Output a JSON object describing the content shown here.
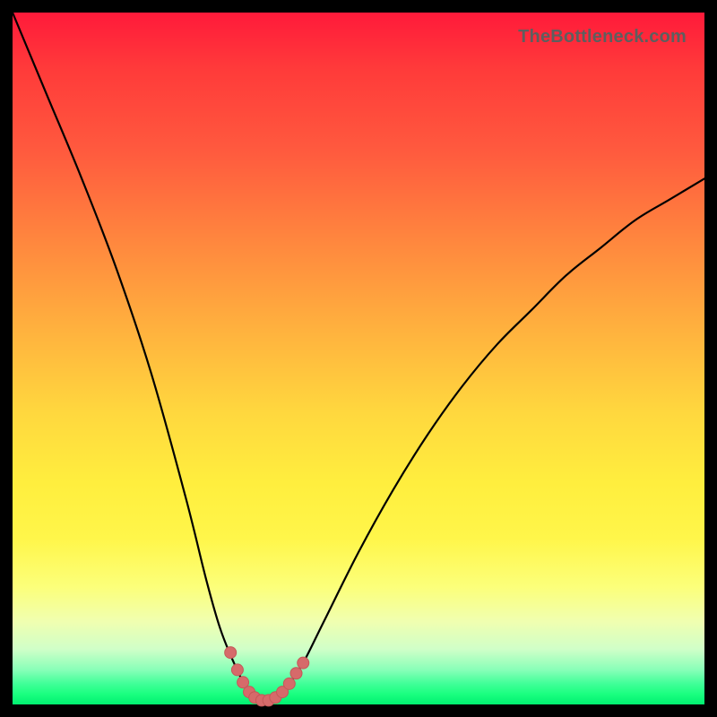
{
  "watermark": "TheBottleneck.com",
  "colors": {
    "curve_stroke": "#000000",
    "marker_fill": "#d66a6a",
    "marker_stroke": "#c45858"
  },
  "chart_data": {
    "type": "line",
    "title": "",
    "xlabel": "",
    "ylabel": "",
    "xlim": [
      0,
      100
    ],
    "ylim": [
      0,
      100
    ],
    "note": "Axes are unlabeled; values estimated from curve shape relative to plot area. y=100 at top (max bottleneck), y≈0 at bottom (optimal).",
    "series": [
      {
        "name": "bottleneck-curve",
        "x": [
          0,
          5,
          10,
          15,
          20,
          25,
          28,
          30,
          32,
          34,
          35,
          36,
          37,
          38,
          40,
          42,
          45,
          50,
          55,
          60,
          65,
          70,
          75,
          80,
          85,
          90,
          95,
          100
        ],
        "y": [
          100,
          88,
          76,
          63,
          48,
          30,
          18,
          11,
          6,
          2,
          1,
          0.5,
          0.5,
          1,
          3,
          6,
          12,
          22,
          31,
          39,
          46,
          52,
          57,
          62,
          66,
          70,
          73,
          76
        ]
      }
    ],
    "markers": {
      "name": "near-optimal-points",
      "x": [
        31.5,
        32.5,
        33.3,
        34.2,
        35.0,
        36.0,
        37.0,
        38.0,
        39.0,
        40.0,
        41.0,
        42.0
      ],
      "y": [
        7.5,
        5.0,
        3.2,
        1.8,
        1.0,
        0.6,
        0.6,
        1.0,
        1.8,
        3.0,
        4.5,
        6.0
      ]
    }
  }
}
